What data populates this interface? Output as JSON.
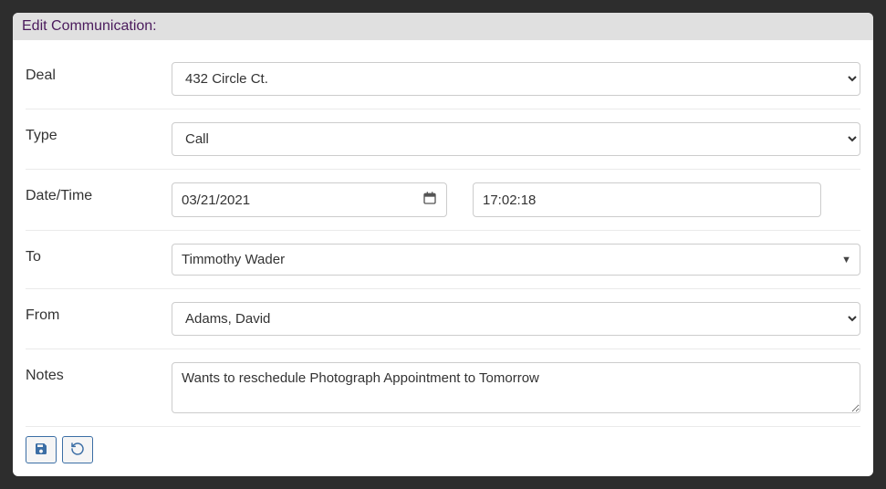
{
  "header": {
    "title": "Edit Communication:"
  },
  "labels": {
    "deal": "Deal",
    "type": "Type",
    "datetime": "Date/Time",
    "to": "To",
    "from": "From",
    "notes": "Notes"
  },
  "fields": {
    "deal": {
      "value": "432 Circle Ct."
    },
    "type": {
      "value": "Call"
    },
    "date": {
      "value": "03/21/2021"
    },
    "time": {
      "value": "17:02:18"
    },
    "to": {
      "value": "Timmothy Wader"
    },
    "from": {
      "value": "Adams, David"
    },
    "notes": {
      "value": "Wants to reschedule Photograph Appointment to Tomorrow"
    }
  }
}
